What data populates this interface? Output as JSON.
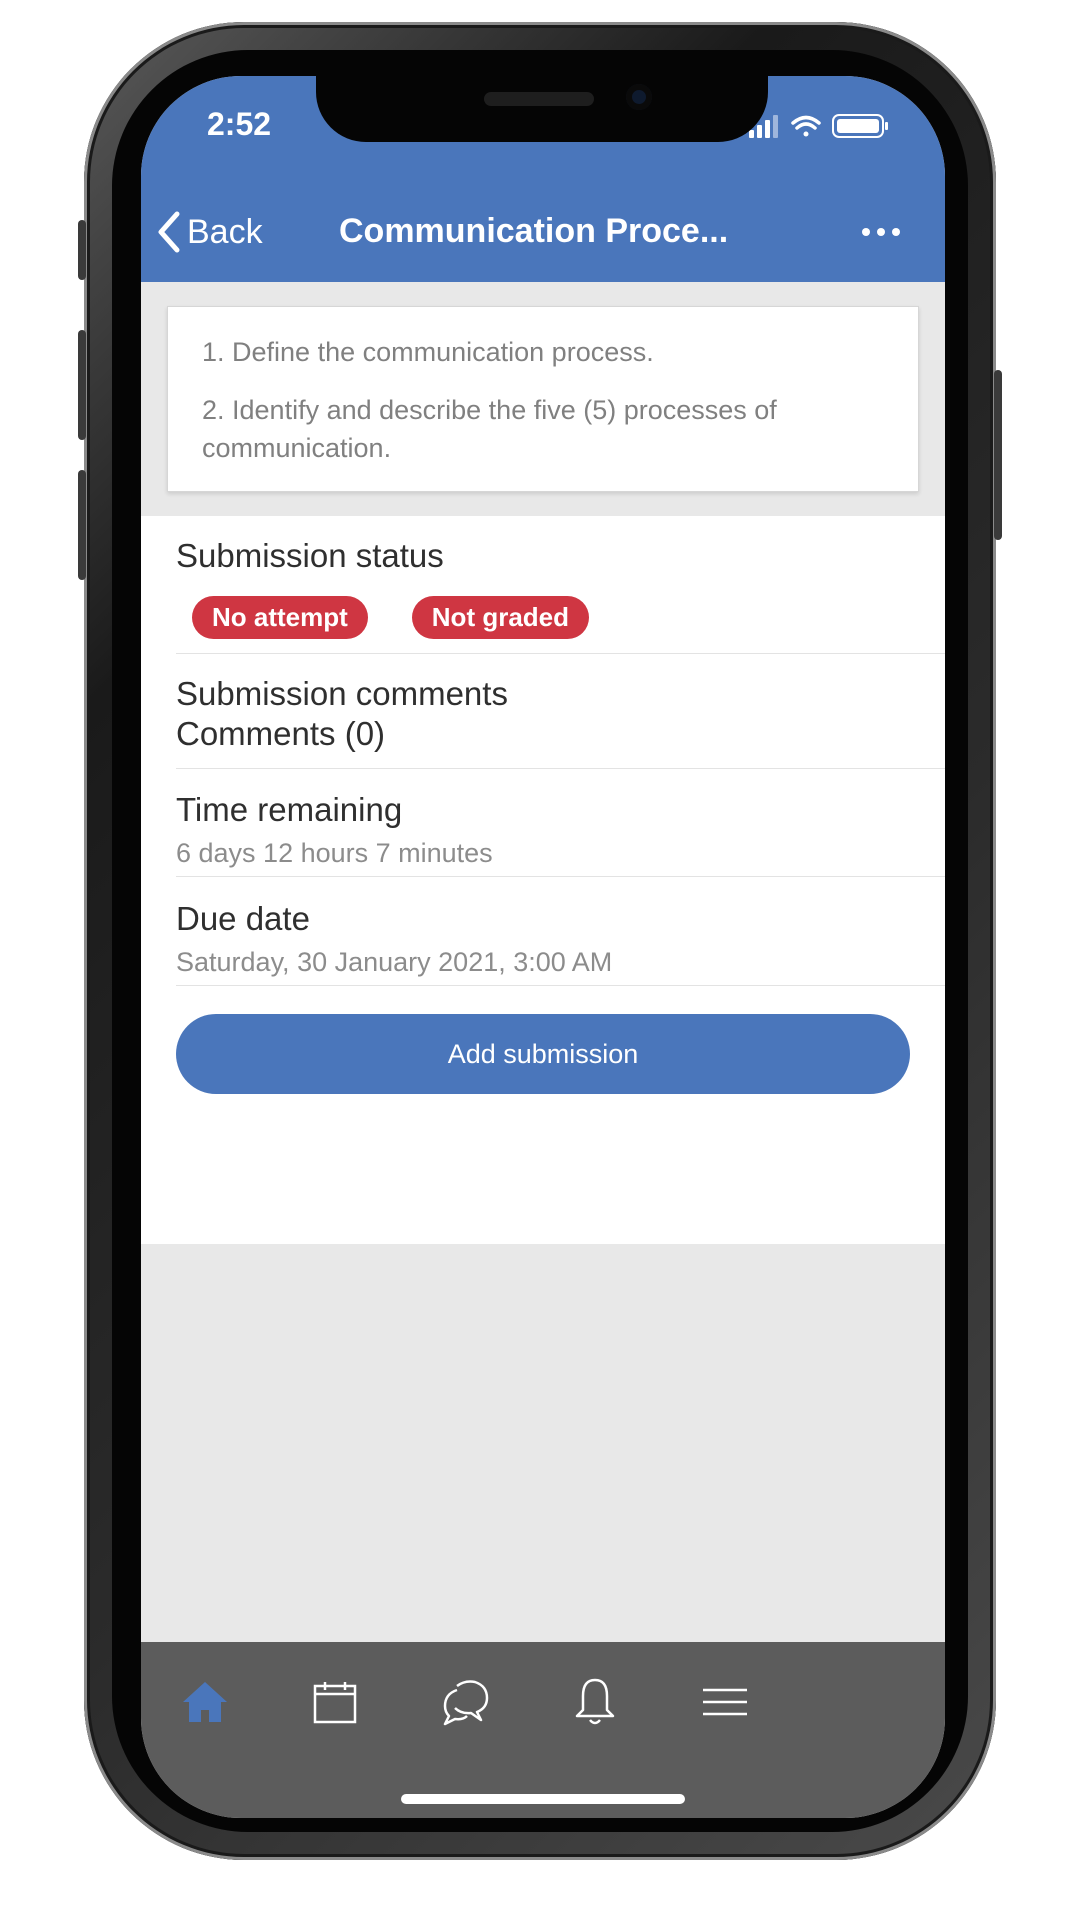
{
  "status_bar": {
    "time": "2:52",
    "icons": [
      "signal-icon",
      "wifi-icon",
      "battery-icon"
    ]
  },
  "nav": {
    "back_label": "Back",
    "title": "Communication Proce...",
    "more_icon": "more-icon"
  },
  "intro": {
    "items": [
      "1. Define the communication process.",
      "2. Identify and describe the five (5) processes of communication."
    ]
  },
  "submission_status": {
    "label": "Submission status",
    "badges": [
      "No attempt",
      "Not graded"
    ]
  },
  "submission_comments": {
    "label": "Submission comments",
    "comments": "Comments (0)"
  },
  "time_remaining": {
    "label": "Time remaining",
    "value": "6 days 12 hours 7 minutes"
  },
  "due_date": {
    "label": "Due date",
    "value": "Saturday, 30 January 2021, 3:00 AM"
  },
  "actions": {
    "add_submission": "Add submission"
  },
  "tabbar": {
    "tabs": [
      "home-icon",
      "calendar-icon",
      "messages-icon",
      "notifications-icon",
      "menu-icon"
    ]
  },
  "colors": {
    "accent": "#4a76bb",
    "badge": "#cf3642",
    "tabbar": "#5c5c5c"
  }
}
